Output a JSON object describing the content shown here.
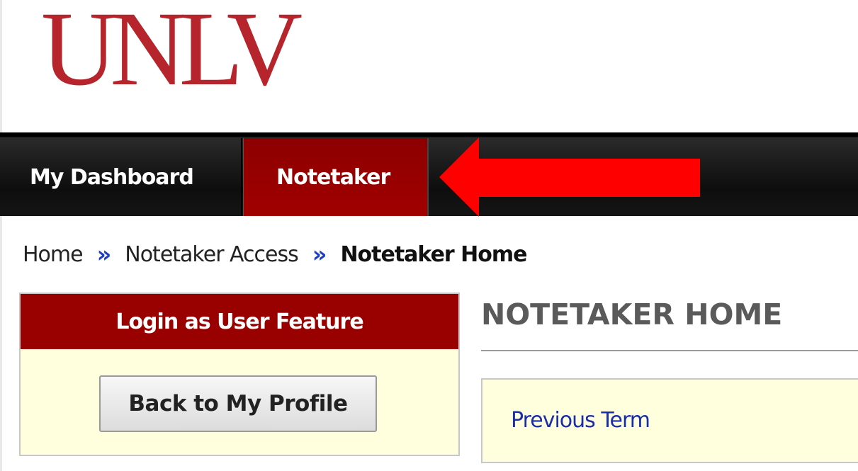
{
  "header": {
    "logo_text": "UNLV",
    "logo_color": "#b5252b"
  },
  "nav": {
    "tabs": [
      {
        "label": "My Dashboard",
        "active": false
      },
      {
        "label": "Notetaker",
        "active": true
      }
    ],
    "active_color": "#990000"
  },
  "annotation": {
    "arrow_color": "#ff0000",
    "arrow_direction": "left"
  },
  "breadcrumb": {
    "items": [
      "Home",
      "Notetaker Access",
      "Notetaker Home"
    ],
    "separator": "»"
  },
  "login_panel": {
    "title": "Login as User Feature",
    "button_label": "Back to My Profile"
  },
  "main": {
    "title": "NOTETAKER HOME",
    "previous_term_link": "Previous Term"
  }
}
